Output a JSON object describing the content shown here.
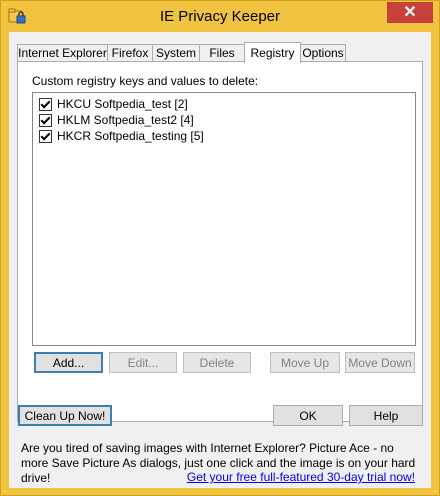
{
  "window": {
    "title": "IE Privacy Keeper"
  },
  "tabs": [
    {
      "label": "Internet Explorer"
    },
    {
      "label": "Firefox"
    },
    {
      "label": "System"
    },
    {
      "label": "Files"
    },
    {
      "label": "Registry"
    },
    {
      "label": "Options"
    }
  ],
  "active_tab": "Registry",
  "registry": {
    "list_label": "Custom registry keys and values to delete:",
    "items": [
      {
        "label": "HKCU Softpedia_test [2]",
        "checked": true
      },
      {
        "label": "HKLM Softpedia_test2 [4]",
        "checked": true
      },
      {
        "label": "HKCR Softpedia_testing [5]",
        "checked": true
      }
    ],
    "buttons": {
      "add": "Add...",
      "edit": "Edit...",
      "delete": "Delete",
      "move_up": "Move Up",
      "move_down": "Move Down"
    }
  },
  "footer": {
    "clean_up": "Clean Up Now!",
    "ok": "OK",
    "help": "Help",
    "info_text": "Are you tired of saving images with Internet Explorer? Picture Ace - no more Save Picture As dialogs, just one click and the image is on your hard drive!",
    "link_text": "Get your free full-featured 30-day trial now!"
  },
  "colors": {
    "frame": "#f0c440",
    "close": "#c7403a",
    "link": "#0000ee"
  },
  "icons": {
    "app": "folder-lock-icon",
    "close": "close-icon"
  }
}
